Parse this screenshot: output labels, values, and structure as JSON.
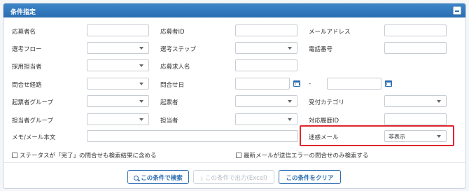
{
  "panel": {
    "title": "条件指定"
  },
  "fields": {
    "applicant_name": "応募者名",
    "applicant_id": "応募者ID",
    "email": "メールアドレス",
    "selection_flow": "選考フロー",
    "selection_step": "選考ステップ",
    "phone": "電話番号",
    "recruiter": "採用担当者",
    "job_title": "応募求人名",
    "inquiry_route": "問合せ経路",
    "inquiry_date": "問合せ日",
    "date_separator": "-",
    "drafter_group": "起票者グループ",
    "drafter": "起票者",
    "reception_category": "受付カテゴリ",
    "assignee_group": "担当者グループ",
    "assignee": "担当者",
    "history_id": "対応履歴ID",
    "memo_body": "メモ/メール本文",
    "spam_mail": "迷惑メール",
    "spam_mail_value": "非表示"
  },
  "checkboxes": {
    "include_completed": "ステータスが「完了」の問合せも検索結果に含める",
    "latest_send_error": "最新メールが送信エラーの問合せのみ検索する"
  },
  "buttons": {
    "search": "この条件で検索",
    "export": "この条件で出力(Excel)",
    "clear": "この条件をクリア"
  },
  "colors": {
    "header": "#2a6db1",
    "highlight": "#e0262d"
  }
}
